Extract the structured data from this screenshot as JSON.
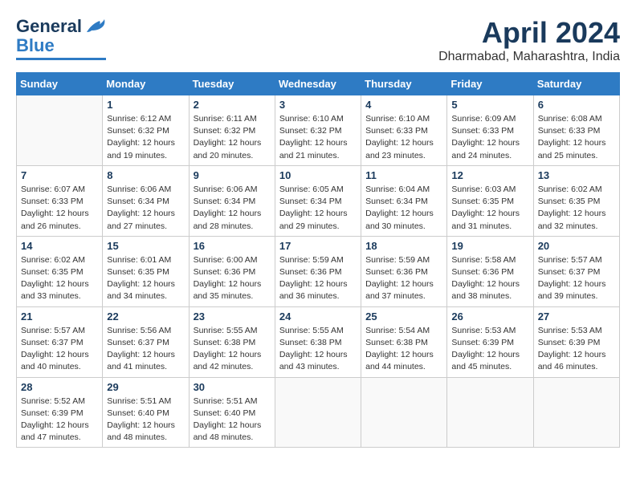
{
  "header": {
    "logo_line1": "General",
    "logo_line2": "Blue",
    "month_title": "April 2024",
    "location": "Dharmabad, Maharashtra, India"
  },
  "days_of_week": [
    "Sunday",
    "Monday",
    "Tuesday",
    "Wednesday",
    "Thursday",
    "Friday",
    "Saturday"
  ],
  "weeks": [
    [
      {
        "day": "",
        "info": ""
      },
      {
        "day": "1",
        "info": "Sunrise: 6:12 AM\nSunset: 6:32 PM\nDaylight: 12 hours\nand 19 minutes."
      },
      {
        "day": "2",
        "info": "Sunrise: 6:11 AM\nSunset: 6:32 PM\nDaylight: 12 hours\nand 20 minutes."
      },
      {
        "day": "3",
        "info": "Sunrise: 6:10 AM\nSunset: 6:32 PM\nDaylight: 12 hours\nand 21 minutes."
      },
      {
        "day": "4",
        "info": "Sunrise: 6:10 AM\nSunset: 6:33 PM\nDaylight: 12 hours\nand 23 minutes."
      },
      {
        "day": "5",
        "info": "Sunrise: 6:09 AM\nSunset: 6:33 PM\nDaylight: 12 hours\nand 24 minutes."
      },
      {
        "day": "6",
        "info": "Sunrise: 6:08 AM\nSunset: 6:33 PM\nDaylight: 12 hours\nand 25 minutes."
      }
    ],
    [
      {
        "day": "7",
        "info": "Sunrise: 6:07 AM\nSunset: 6:33 PM\nDaylight: 12 hours\nand 26 minutes."
      },
      {
        "day": "8",
        "info": "Sunrise: 6:06 AM\nSunset: 6:34 PM\nDaylight: 12 hours\nand 27 minutes."
      },
      {
        "day": "9",
        "info": "Sunrise: 6:06 AM\nSunset: 6:34 PM\nDaylight: 12 hours\nand 28 minutes."
      },
      {
        "day": "10",
        "info": "Sunrise: 6:05 AM\nSunset: 6:34 PM\nDaylight: 12 hours\nand 29 minutes."
      },
      {
        "day": "11",
        "info": "Sunrise: 6:04 AM\nSunset: 6:34 PM\nDaylight: 12 hours\nand 30 minutes."
      },
      {
        "day": "12",
        "info": "Sunrise: 6:03 AM\nSunset: 6:35 PM\nDaylight: 12 hours\nand 31 minutes."
      },
      {
        "day": "13",
        "info": "Sunrise: 6:02 AM\nSunset: 6:35 PM\nDaylight: 12 hours\nand 32 minutes."
      }
    ],
    [
      {
        "day": "14",
        "info": "Sunrise: 6:02 AM\nSunset: 6:35 PM\nDaylight: 12 hours\nand 33 minutes."
      },
      {
        "day": "15",
        "info": "Sunrise: 6:01 AM\nSunset: 6:35 PM\nDaylight: 12 hours\nand 34 minutes."
      },
      {
        "day": "16",
        "info": "Sunrise: 6:00 AM\nSunset: 6:36 PM\nDaylight: 12 hours\nand 35 minutes."
      },
      {
        "day": "17",
        "info": "Sunrise: 5:59 AM\nSunset: 6:36 PM\nDaylight: 12 hours\nand 36 minutes."
      },
      {
        "day": "18",
        "info": "Sunrise: 5:59 AM\nSunset: 6:36 PM\nDaylight: 12 hours\nand 37 minutes."
      },
      {
        "day": "19",
        "info": "Sunrise: 5:58 AM\nSunset: 6:36 PM\nDaylight: 12 hours\nand 38 minutes."
      },
      {
        "day": "20",
        "info": "Sunrise: 5:57 AM\nSunset: 6:37 PM\nDaylight: 12 hours\nand 39 minutes."
      }
    ],
    [
      {
        "day": "21",
        "info": "Sunrise: 5:57 AM\nSunset: 6:37 PM\nDaylight: 12 hours\nand 40 minutes."
      },
      {
        "day": "22",
        "info": "Sunrise: 5:56 AM\nSunset: 6:37 PM\nDaylight: 12 hours\nand 41 minutes."
      },
      {
        "day": "23",
        "info": "Sunrise: 5:55 AM\nSunset: 6:38 PM\nDaylight: 12 hours\nand 42 minutes."
      },
      {
        "day": "24",
        "info": "Sunrise: 5:55 AM\nSunset: 6:38 PM\nDaylight: 12 hours\nand 43 minutes."
      },
      {
        "day": "25",
        "info": "Sunrise: 5:54 AM\nSunset: 6:38 PM\nDaylight: 12 hours\nand 44 minutes."
      },
      {
        "day": "26",
        "info": "Sunrise: 5:53 AM\nSunset: 6:39 PM\nDaylight: 12 hours\nand 45 minutes."
      },
      {
        "day": "27",
        "info": "Sunrise: 5:53 AM\nSunset: 6:39 PM\nDaylight: 12 hours\nand 46 minutes."
      }
    ],
    [
      {
        "day": "28",
        "info": "Sunrise: 5:52 AM\nSunset: 6:39 PM\nDaylight: 12 hours\nand 47 minutes."
      },
      {
        "day": "29",
        "info": "Sunrise: 5:51 AM\nSunset: 6:40 PM\nDaylight: 12 hours\nand 48 minutes."
      },
      {
        "day": "30",
        "info": "Sunrise: 5:51 AM\nSunset: 6:40 PM\nDaylight: 12 hours\nand 48 minutes."
      },
      {
        "day": "",
        "info": ""
      },
      {
        "day": "",
        "info": ""
      },
      {
        "day": "",
        "info": ""
      },
      {
        "day": "",
        "info": ""
      }
    ]
  ]
}
